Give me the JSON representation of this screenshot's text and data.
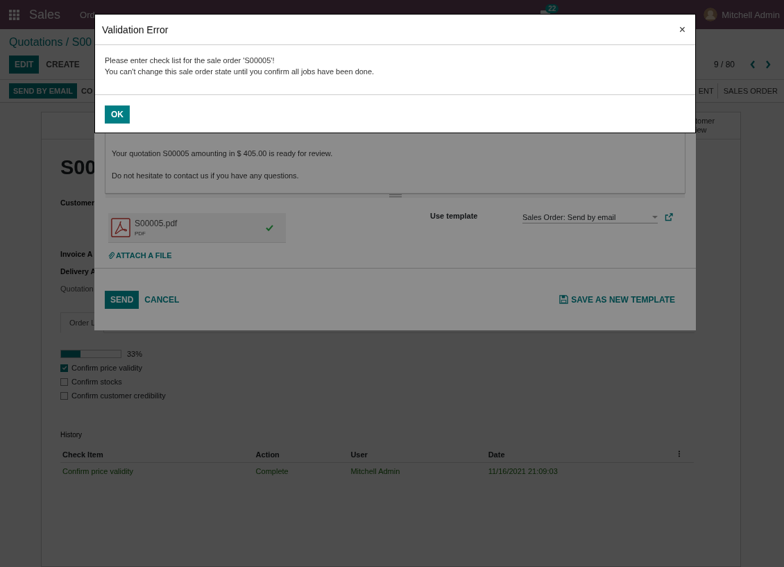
{
  "top_bar": {
    "app_name": "Sales",
    "menu": [
      "Ord"
    ],
    "chat_badge": "22",
    "user": "Mitchell Admin"
  },
  "breadcrumb": "Quotations / S00",
  "actions": [
    {
      "label": "EDIT",
      "kind": "primary"
    },
    {
      "label": "CREATE",
      "kind": "plain"
    }
  ],
  "pager": "9 / 80",
  "status_bar": {
    "buttons": [
      {
        "label": "SEND BY EMAIL",
        "kind": "primary"
      },
      {
        "label": "CO",
        "kind": "plain"
      }
    ],
    "stages": [
      "ENT",
      "SALES ORDER"
    ]
  },
  "smart_button": {
    "lines": [
      "tomer",
      "iew"
    ]
  },
  "form": {
    "title": "S00",
    "fields": [
      "Customer",
      "Invoice A",
      "Delivery A"
    ],
    "note": "Quotation",
    "tabs": [
      {
        "label": "Order L",
        "selected": true
      }
    ]
  },
  "checklist": {
    "level": 0.33,
    "reading": "33%",
    "items": [
      {
        "label": "Confirm price validity",
        "checked": true
      },
      {
        "label": "Confirm stocks",
        "checked": false
      },
      {
        "label": "Confirm customer credibility",
        "checked": false
      }
    ]
  },
  "history": {
    "title": "History",
    "columns": [
      "Check Item",
      "Action",
      "User",
      "Date"
    ],
    "rows": [
      [
        "Confirm price validity",
        "Complete",
        "Mitchell Admin",
        "11/16/2021 21:09:03"
      ]
    ]
  },
  "send_dialog": {
    "body_lines": [
      "Your quotation S00005 amounting in $ 405.00 is ready for review.",
      "Do not hesitate to contact us if you have any questions."
    ],
    "attachment": {
      "name": "S00005.pdf",
      "type": "PDF"
    },
    "attach_link": "ATTACH A FILE",
    "template_label": "Use template",
    "template_value": "Sales Order: Send by email",
    "buttons": [
      {
        "label": "SEND",
        "kind": "primary"
      },
      {
        "label": "CANCEL",
        "kind": "link"
      }
    ],
    "save_template": "SAVE AS NEW TEMPLATE"
  },
  "validation_dialog": {
    "title": "Validation Error",
    "close": "×",
    "lines": [
      "Please enter check list for the sale order 'S00005'!",
      "You can't change this sale order state until you confirm all jobs have been done."
    ],
    "button": "OK"
  }
}
